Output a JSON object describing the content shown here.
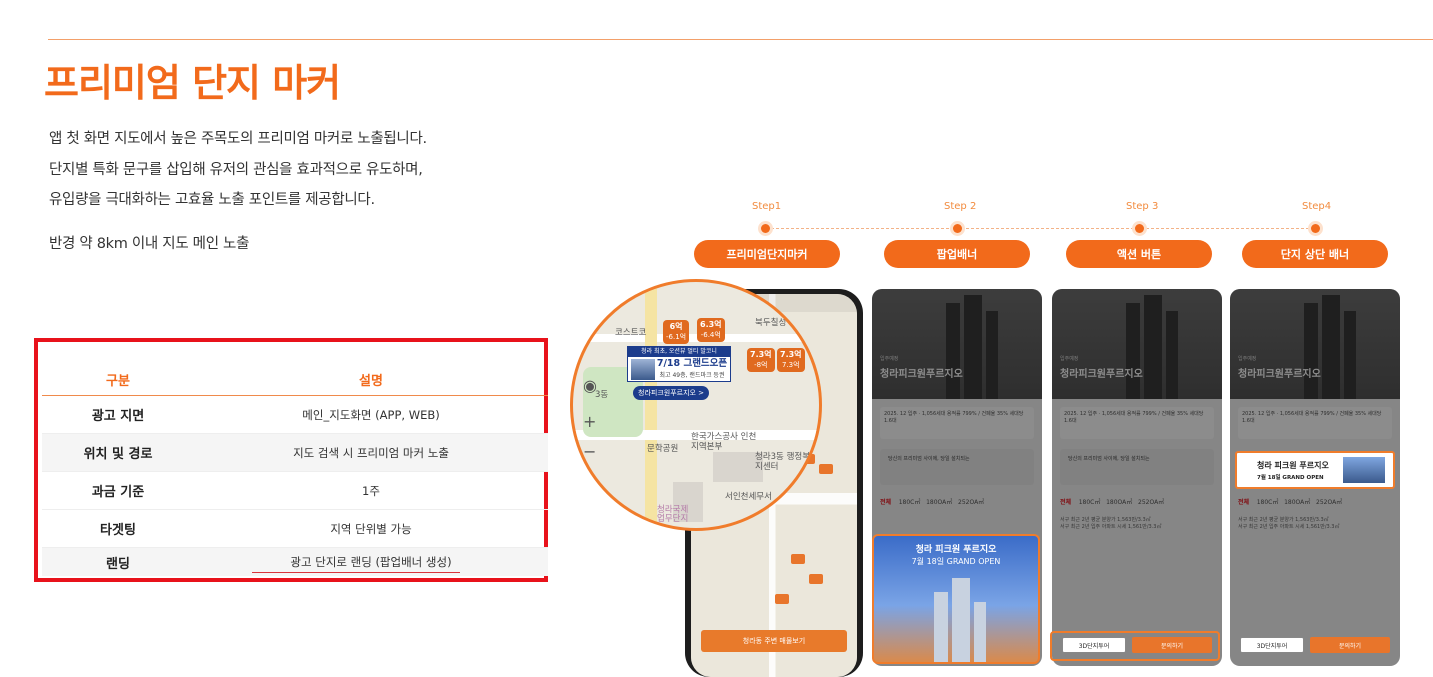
{
  "title": "프리미엄 단지 마커",
  "description": [
    "앱 첫 화면 지도에서 높은 주목도의 프리미엄 마커로 노출됩니다.",
    "단지별 특화 문구를 삽입해 유저의 관심을 효과적으로 유도하며,",
    "유입량을 극대화하는 고효율 노출 포인트를 제공합니다."
  ],
  "reach": "반경 약 8km 이내 지도 메인 노출",
  "table": {
    "headers": [
      "구분",
      "설명"
    ],
    "rows": [
      {
        "label": "광고 지면",
        "value": "메인_지도화면 (APP, WEB)"
      },
      {
        "label": "위치 및 경로",
        "value": "지도 검색 시 프리미엄 마커 노출"
      },
      {
        "label": "과금 기준",
        "value": "1주"
      },
      {
        "label": "타겟팅",
        "value": "지역 단위별 가능"
      },
      {
        "label": "랜딩",
        "value": "광고 단지로 랜딩 (팝업배너 생성)"
      }
    ]
  },
  "steps": [
    {
      "step": "Step1",
      "label": "프리미엄단지마커"
    },
    {
      "step": "Step 2",
      "label": "팝업배너"
    },
    {
      "step": "Step 3",
      "label": "액션 버튼"
    },
    {
      "step": "Step4",
      "label": "단지 상단 배너"
    }
  ],
  "map": {
    "markers": [
      {
        "price": "6억",
        "change": "-6.1억"
      },
      {
        "price": "6.3억",
        "change": "-6.4억"
      },
      {
        "price": "7.3억",
        "change": "-8억"
      },
      {
        "price": "7.3억",
        "change": "7.3억"
      }
    ],
    "premium_head": "청라 최초, 오션뷰 멀티 발코니",
    "premium_title": "7/18 그랜드오픈",
    "premium_sub": "최고 49층, 랜드마크 등권",
    "premium_tag": "청라피크원푸르지오 >",
    "labels": [
      "코스트코",
      "북두칠성",
      "문학공원",
      "한국가스공사 인천지역본부",
      "청라3동 행정복지센터",
      "서인천세무서",
      "청라국제 업무단지",
      "3동"
    ],
    "cta": "청라동 주변 매물보기"
  },
  "screen": {
    "small": "입주예정",
    "apt_name": "청라피크원푸르지오",
    "info": "2025. 12 입주 · 1,056세대  용적률 799% / 건폐율 35%  세대당 1.6대",
    "detail_btn": "자세히 보기",
    "ad_text": "당신의 프리미엄 사이에, 당일 설치되는",
    "tabs": [
      "전체",
      "180C㎡",
      "180OA㎡",
      "252OA㎡"
    ],
    "list": [
      "서구 최근 2년 평균 분양가  1,563만/3.3㎡",
      "서구 최근 2년 입주 아파트 시세  1,561만/3.3㎡"
    ],
    "btn_3d": "3D단지투어",
    "btn_inquiry": "문의하기"
  },
  "popup": {
    "title": "청라 피크원 푸르지오",
    "subtitle": "7월 18일 GRAND OPEN"
  },
  "header_banner": {
    "title": "청라 피크원 푸르지오",
    "subtitle": "7월 18일 GRAND OPEN"
  },
  "colors": {
    "accent": "#f26a1b",
    "highlight_border": "#e8121b",
    "premium_blue": "#1c3c8c"
  }
}
